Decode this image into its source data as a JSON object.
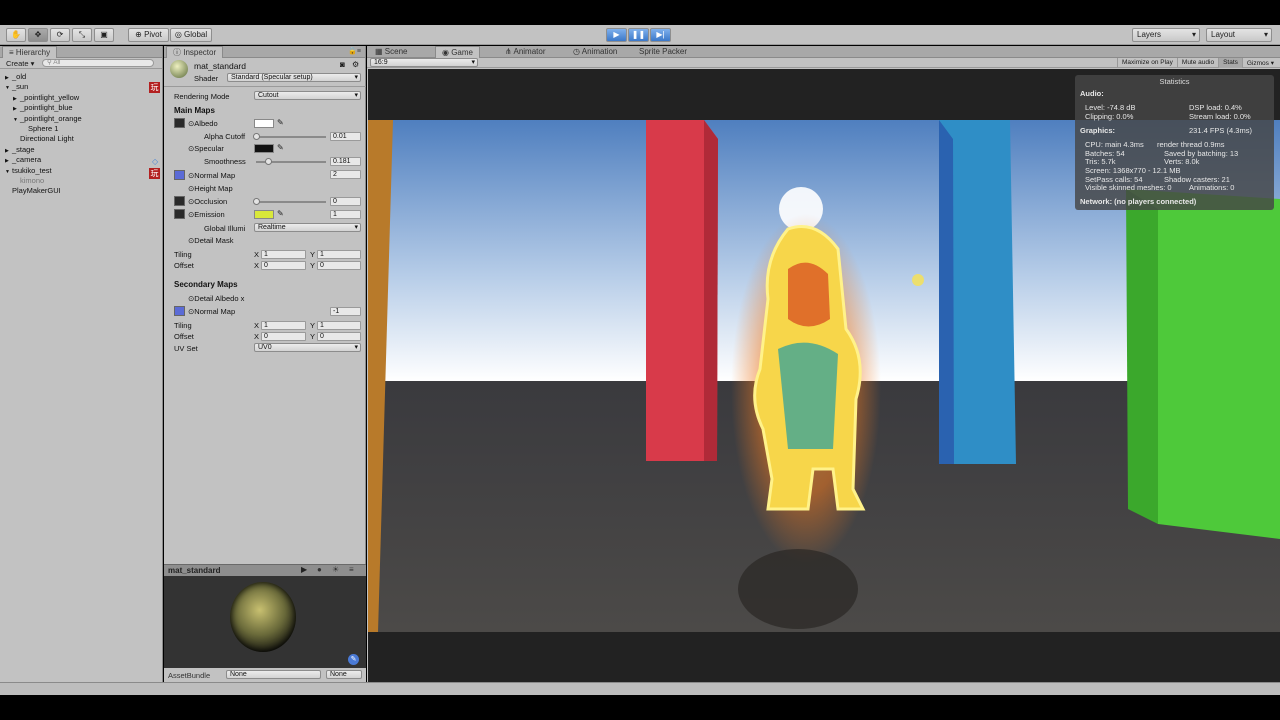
{
  "toolbar": {
    "pivot": "Pivot",
    "global": "Global",
    "layers": "Layers",
    "layout": "Layout",
    "tools": [
      "hand",
      "move",
      "rotate",
      "scale",
      "rect"
    ]
  },
  "hierarchy": {
    "tab": "Hierarchy",
    "create": "Create",
    "search_placeholder": "All",
    "items": [
      {
        "label": "_old",
        "indent": 0,
        "arrow": "▶"
      },
      {
        "label": "_sun",
        "indent": 0,
        "arrow": "▼"
      },
      {
        "label": "_pointlight_yellow",
        "indent": 1,
        "arrow": "▶"
      },
      {
        "label": "_pointlight_blue",
        "indent": 1,
        "arrow": "▶"
      },
      {
        "label": "_pointlight_orange",
        "indent": 1,
        "arrow": "▼"
      },
      {
        "label": "Sphere 1",
        "indent": 2,
        "arrow": ""
      },
      {
        "label": "Directional Light",
        "indent": 1,
        "arrow": ""
      },
      {
        "label": "_stage",
        "indent": 0,
        "arrow": "▶"
      },
      {
        "label": "_camera",
        "indent": 0,
        "arrow": "▶"
      },
      {
        "label": "tsukiko_test",
        "indent": 0,
        "arrow": "▼"
      },
      {
        "label": "kimono",
        "indent": 1,
        "arrow": "",
        "dim": true
      },
      {
        "label": "PlayMakerGUI",
        "indent": 0,
        "arrow": ""
      }
    ]
  },
  "inspector": {
    "tab": "Inspector",
    "material": "mat_standard",
    "shader_label": "Shader",
    "shader_value": "Standard (Specular setup)",
    "rendering_mode_label": "Rendering Mode",
    "rendering_mode_value": "Cutout",
    "main_maps": "Main Maps",
    "albedo": "Albedo",
    "alpha_cutoff": "Alpha Cutoff",
    "alpha_cutoff_value": "0.01",
    "specular": "Specular",
    "smoothness": "Smoothness",
    "smoothness_value": "0.181",
    "normal_map": "Normal Map",
    "normal_map_value": "2",
    "height_map": "Height Map",
    "occlusion": "Occlusion",
    "occlusion_value": "0",
    "emission": "Emission",
    "emission_value": "1",
    "global_illum": "Global Illumi",
    "global_illum_value": "Realtime",
    "detail_mask": "Detail Mask",
    "tiling": "Tiling",
    "offset": "Offset",
    "x": "X",
    "y": "Y",
    "tiling_x": "1",
    "tiling_y": "1",
    "offset_x": "0",
    "offset_y": "0",
    "secondary_maps": "Secondary Maps",
    "detail_albedo": "Detail Albedo x",
    "normal_map2": "Normal Map",
    "normal_map2_value": "-1",
    "tiling2_x": "1",
    "tiling2_y": "1",
    "offset2_x": "0",
    "offset2_y": "0",
    "uv_set": "UV Set",
    "uv_set_value": "UV0",
    "preview_title": "mat_standard",
    "assetbundle_label": "AssetBundle",
    "assetbundle_value": "None",
    "assetbundle_variant": "None"
  },
  "viewport": {
    "tabs": [
      "Scene",
      "Game",
      "Animator",
      "Animation",
      "Sprite Packer"
    ],
    "active_tab": "Game",
    "aspect": "16:9",
    "right_buttons": [
      "Maximize on Play",
      "Mute audio",
      "Stats",
      "Gizmos"
    ]
  },
  "stats": {
    "title": "Statistics",
    "audio": "Audio:",
    "level": "Level: -74.8 dB",
    "clipping": "Clipping: 0.0%",
    "dsp": "DSP load: 0.4%",
    "stream": "Stream load: 0.0%",
    "graphics": "Graphics:",
    "fps": "231.4 FPS (4.3ms)",
    "cpu": "CPU: main 4.3ms",
    "render_thread": "render thread 0.9ms",
    "batches": "Batches: 54",
    "saved": "Saved by batching: 13",
    "tris": "Tris: 5.7k",
    "verts": "Verts: 8.0k",
    "screen": "Screen: 1368x770 - 12.1 MB",
    "setpass": "SetPass calls: 54",
    "shadow": "Shadow casters: 21",
    "skinned": "Visible skinned meshes: 0",
    "animations": "Animations: 0",
    "network": "Network: (no players connected)"
  },
  "colors": {
    "accent_blue": "#3b78c9",
    "panel": "#c2c2c2",
    "emission": "#d9e83a"
  }
}
